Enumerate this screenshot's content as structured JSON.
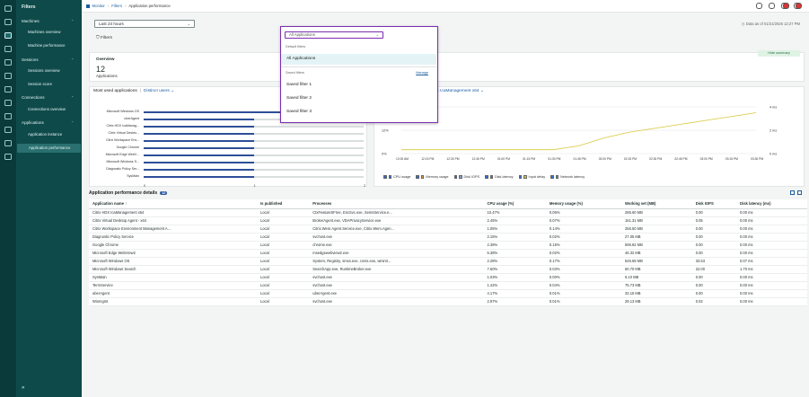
{
  "nav": {
    "title": "Filters",
    "groups": [
      {
        "label": "Machines",
        "items": [
          "Machines overview",
          "Machine performance"
        ]
      },
      {
        "label": "Sessions",
        "items": [
          "Sessions overview",
          "Session score"
        ]
      },
      {
        "label": "Connections",
        "items": [
          "Connections overview"
        ]
      },
      {
        "label": "Applications",
        "items": [
          "Application instance",
          "Application performance"
        ]
      }
    ],
    "expand_glyph": "»"
  },
  "breadcrumb": {
    "root": "Monitor",
    "mid": "Filters",
    "current": "Application performance"
  },
  "toolbar": {
    "time_range": "Last 24 hours",
    "filters_label": "Filters",
    "data_freshness": "Data as of 01/21/2026 12:27 PM",
    "hide_summary": "Hide summary"
  },
  "dropdown": {
    "value": "All Applications",
    "default_header": "Default filters",
    "default_options": [
      "All Applications"
    ],
    "saved_header": "Saved filters",
    "manage_label": "Manage",
    "saved_options": [
      "Saved filter 1",
      "Saved filter 2",
      "Saved filter 3"
    ]
  },
  "overview": {
    "title": "Overview",
    "left_value": "12",
    "left_label": "Applications",
    "right_value": "12",
    "right_label": "Local"
  },
  "most_used": {
    "title": "Most used applications",
    "dropdown": "Distinct users",
    "ticks": [
      "0",
      "1",
      "2"
    ]
  },
  "trends": {
    "title": "Application trends",
    "dropdown": "Citrix HDX IcaManagement x64",
    "y_left": [
      "24%",
      "12%",
      "0%"
    ],
    "y_right": [
      "4 ms",
      "2 ms",
      "0 ms"
    ],
    "x_labels": [
      "12:00 AM",
      "12:15 PM",
      "12:30 PM",
      "12:45 PM",
      "01:00 PM",
      "01:15 PM",
      "01:30 PM",
      "01:45 PM",
      "02:00 PM",
      "02:15 PM",
      "02:30 PM",
      "02:45 PM",
      "03:00 PM",
      "03:15 PM",
      "03:30 PM"
    ],
    "legend": [
      "CPU usage",
      "Memory usage",
      "Disk IOPS",
      "Disk latency",
      "Input delay",
      "Network latency"
    ],
    "legend_colors": [
      "#2d6ad8",
      "#e6a23c",
      "#7aa6d8",
      "#c0507a",
      "#d8c83a",
      "#3aa8a0"
    ]
  },
  "chart_data": [
    {
      "type": "bar",
      "title": "Most used applications",
      "categories": [
        "Microsoft Windows OS",
        "uberAgent",
        "Citrix HDX IcaManag...",
        "Citrix Virtual Deskto...",
        "Citrix Workspace Env...",
        "Google Chrome",
        "Microsoft Edge WebV...",
        "Microsoft Windows S...",
        "Diagnostic Policy Ser...",
        "SysMain"
      ],
      "values": [
        2,
        1,
        1,
        1,
        1,
        1,
        1,
        1,
        1,
        1
      ],
      "xlim": [
        0,
        2
      ]
    },
    {
      "type": "line",
      "title": "Application trends",
      "x": [
        "12:00 AM",
        "12:15 PM",
        "12:30 PM",
        "12:45 PM",
        "01:00 PM",
        "01:15 PM",
        "01:30 PM",
        "01:45 PM",
        "02:00 PM",
        "02:15 PM",
        "02:30 PM",
        "02:45 PM",
        "03:00 PM",
        "03:15 PM",
        "03:30 PM"
      ],
      "series": [
        {
          "name": "CPU usage",
          "values": [
            null,
            null,
            null,
            null,
            null,
            null,
            null,
            null,
            null,
            null,
            null,
            null,
            null,
            null,
            null
          ]
        },
        {
          "name": "Memory usage",
          "values": [
            2,
            2,
            2,
            2,
            2,
            2,
            2,
            4,
            8,
            11,
            13,
            15,
            17,
            19,
            21
          ]
        }
      ],
      "ylim": [
        0,
        24
      ]
    }
  ],
  "details": {
    "title": "Application performance details",
    "count": "12",
    "columns": [
      "Application name",
      "Is published",
      "Processes",
      "CPU usage (%)",
      "Memory usage (%)",
      "Working set (MB)",
      "Disk IOPS",
      "Disk latency (ms)"
    ],
    "rows": [
      [
        "Citrix HDX IcaManagement x64",
        "Local",
        "CtxFeatureSFree, EncSvc.exe, SemsService.e...",
        "10.47%",
        "0.06%",
        "286.60 MB",
        "0.00",
        "0.00 ms"
      ],
      [
        "Citrix Virtual Desktop Agent - x64",
        "Local",
        "BrokerAgent.exe, VDAPrivacyService.exe",
        "2.45%",
        "0.07%",
        "161.31 MB",
        "0.05",
        "0.00 ms"
      ],
      [
        "Citrix Workspace Environment Management A...",
        "Local",
        "Citrix.Wem.Agent.Service.exe, Citrix.Wem.Agen...",
        "1.05%",
        "0.14%",
        "256.50 MB",
        "0.00",
        "0.00 ms"
      ],
      [
        "Diagnostic Policy Service",
        "Local",
        "svchost.exe",
        "2.15%",
        "0.02%",
        "27.05 MB",
        "0.00",
        "0.00 ms"
      ],
      [
        "Google Chrome",
        "Local",
        "chrome.exe",
        "2.38%",
        "0.15%",
        "596.82 MB",
        "0.00",
        "0.00 ms"
      ],
      [
        "Microsoft Edge WebView2",
        "Local",
        "msedgewebview2.exe",
        "5.38%",
        "0.02%",
        "46.32 MB",
        "0.00",
        "0.00 ms"
      ],
      [
        "Microsoft Windows OS",
        "Local",
        "System, Registry, smss.exe, csrss.exe, wininit...",
        "2.28%",
        "0.17%",
        "545.68 MB",
        "33.53",
        "0.07 ms"
      ],
      [
        "Microsoft Windows Search",
        "Local",
        "SearchApp.exe, RuntimeBroker.exe",
        "7.60%",
        "0.03%",
        "60.70 MB",
        "22.00",
        "1.70 ms"
      ],
      [
        "SysMain",
        "Local",
        "svchost.exe",
        "1.03%",
        "0.00%",
        "6.10 MB",
        "0.00",
        "0.00 ms"
      ],
      [
        "TermService",
        "Local",
        "svchost.exe",
        "1.42%",
        "0.04%",
        "75.73 MB",
        "0.00",
        "0.00 ms"
      ],
      [
        "uberAgent",
        "Local",
        "uberAgent.exe",
        "4.17%",
        "0.01%",
        "33.15 MB",
        "0.00",
        "0.00 ms"
      ],
      [
        "Winmgmt",
        "Local",
        "svchost.exe",
        "2.97%",
        "0.01%",
        "29.13 MB",
        "0.02",
        "0.00 ms"
      ]
    ]
  }
}
